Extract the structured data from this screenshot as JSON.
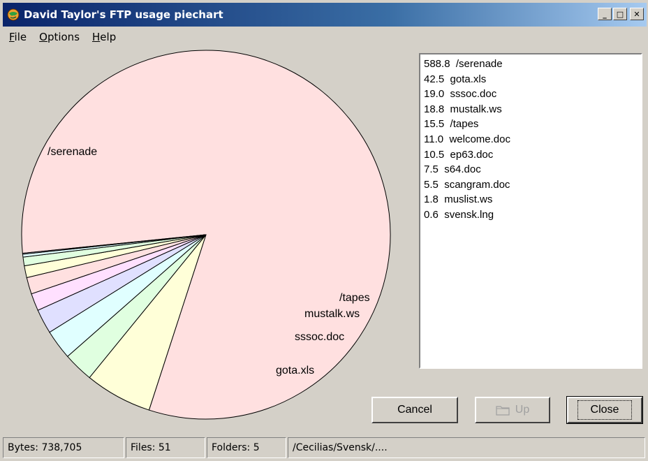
{
  "window": {
    "title": "David Taylor's FTP usage piechart",
    "minimize_glyph": "_",
    "maximize_glyph": "□",
    "close_glyph": "✕",
    "icon": "globe-icon"
  },
  "menu": [
    {
      "accel": "F",
      "rest": "ile"
    },
    {
      "accel": "O",
      "rest": "ptions"
    },
    {
      "accel": "H",
      "rest": "elp"
    }
  ],
  "chart_data": {
    "type": "pie",
    "slices": [
      {
        "name": "/serenade",
        "value": 588.8,
        "color": "#ffe0e0",
        "label": "/serenade"
      },
      {
        "name": "gota.xls",
        "value": 42.5,
        "color": "#ffffd8",
        "label": "gota.xls"
      },
      {
        "name": "sssoc.doc",
        "value": 19.0,
        "color": "#e0ffe0",
        "label": "sssoc.doc"
      },
      {
        "name": "mustalk.ws",
        "value": 18.8,
        "color": "#e0ffff",
        "label": "mustalk.ws"
      },
      {
        "name": "/tapes",
        "value": 15.5,
        "color": "#e0e0ff",
        "label": "/tapes"
      },
      {
        "name": "welcome.doc",
        "value": 11.0,
        "color": "#ffe0ff",
        "label": ""
      },
      {
        "name": "ep63.doc",
        "value": 10.5,
        "color": "#ffe0e0",
        "label": ""
      },
      {
        "name": "s64.doc",
        "value": 7.5,
        "color": "#ffffd8",
        "label": ""
      },
      {
        "name": "scangram.doc",
        "value": 5.5,
        "color": "#e0ffe0",
        "label": ""
      },
      {
        "name": "muslist.ws",
        "value": 1.8,
        "color": "#e0ffff",
        "label": ""
      },
      {
        "name": "svensk.lng",
        "value": 0.6,
        "color": "#e0e0ff",
        "label": ""
      }
    ]
  },
  "list": [
    {
      "size": "588.8",
      "name": "/serenade"
    },
    {
      "size": "42.5",
      "name": "gota.xls"
    },
    {
      "size": "19.0",
      "name": "sssoc.doc"
    },
    {
      "size": "18.8",
      "name": "mustalk.ws"
    },
    {
      "size": "15.5",
      "name": "/tapes"
    },
    {
      "size": "11.0",
      "name": "welcome.doc"
    },
    {
      "size": "10.5",
      "name": "ep63.doc"
    },
    {
      "size": "7.5",
      "name": "s64.doc"
    },
    {
      "size": "5.5",
      "name": "scangram.doc"
    },
    {
      "size": "1.8",
      "name": "muslist.ws"
    },
    {
      "size": "0.6",
      "name": "svensk.lng"
    }
  ],
  "buttons": {
    "cancel": "Cancel",
    "up": "Up",
    "close": "Close"
  },
  "status": {
    "bytes": "Bytes: 738,705",
    "files": "Files: 51",
    "folders": "Folders: 5",
    "path": "/Cecilias/Svensk/...."
  }
}
